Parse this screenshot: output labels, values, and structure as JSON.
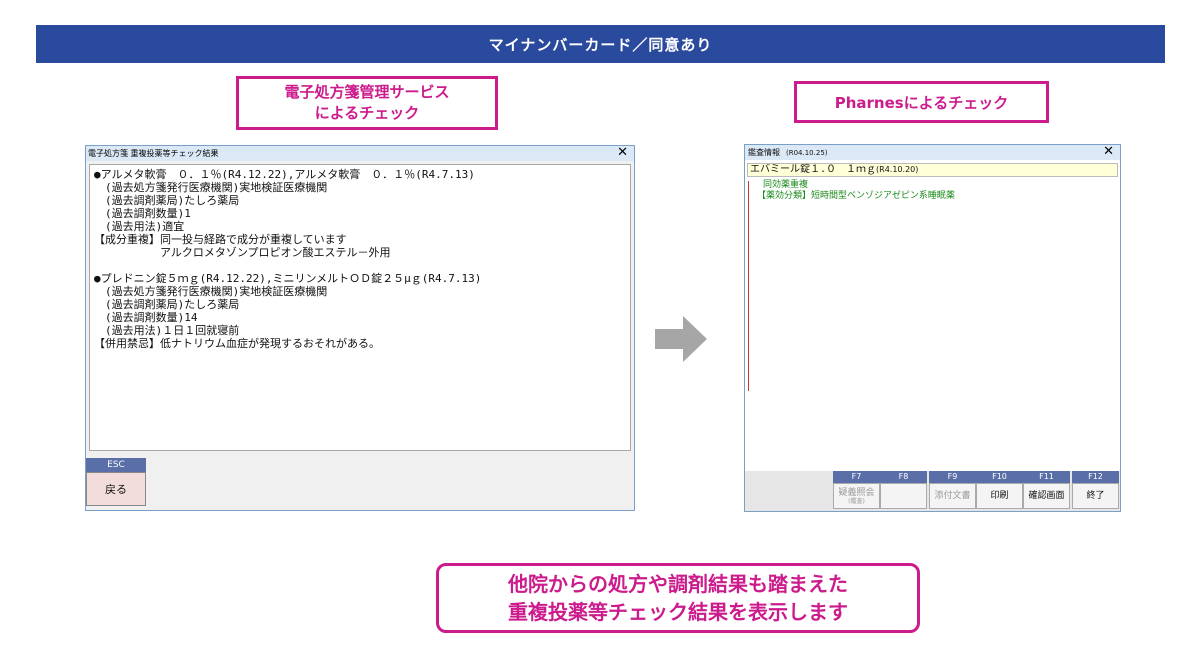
{
  "banner": {
    "text": "マイナンバーカード／同意あり"
  },
  "callouts": {
    "left_line1": "電子処方箋管理サービス",
    "left_line2": "によるチェック",
    "right": "Pharnesによるチェック",
    "bottom_line1": "他院からの処方や調剤結果も踏まえた",
    "bottom_line2": "重複投薬等チェック結果を表示します"
  },
  "left_window": {
    "title": "電子処方箋 重複投薬等チェック結果",
    "close": "✕",
    "lines": [
      "●アルメタ軟膏　０．１％(R4.12.22),アルメタ軟膏　０．１％(R4.7.13)",
      "　(過去処方箋発行医療機関)実地検証医療機関",
      "　(過去調剤薬局)たしろ薬局",
      "　(過去調剤数量)1",
      "　(過去用法)適宜",
      "【成分重複】同一投与経路で成分が重複しています",
      "　　　　　　アルクロメタゾンプロピオン酸エステル－外用",
      "",
      "●プレドニン錠５ｍｇ(R4.12.22),ミニリンメルトＯＤ錠２５μｇ(R4.7.13)",
      "　(過去処方箋発行医療機関)実地検証医療機関",
      "　(過去調剤薬局)たしろ薬局",
      "　(過去調剤数量)14",
      "　(過去用法)１日１回就寝前",
      "【併用禁忌】低ナトリウム血症が発現するおそれがある。"
    ],
    "esc_label": "ESC",
    "back_button": "戻る"
  },
  "right_window": {
    "title": "鑑査情報",
    "title_date": "(R04.10.25)",
    "close": "✕",
    "drug_name": "エバミール錠１.０　１ｍｇ",
    "drug_date": "(R4.10.20)",
    "detail_line1": "同効薬重複",
    "detail_line2": "【薬効分類】短時間型ベンゾジアゼピン系睡眠薬",
    "fkeys": [
      {
        "key": "F7",
        "label": "疑義照会",
        "sub": "(鑑査)",
        "enabled": false
      },
      {
        "key": "F8",
        "label": "",
        "sub": "",
        "enabled": false
      },
      {
        "key": "F9",
        "label": "添付文書",
        "sub": "",
        "enabled": false
      },
      {
        "key": "F10",
        "label": "印刷",
        "sub": "",
        "enabled": true
      },
      {
        "key": "F11",
        "label": "確認画面",
        "sub": "",
        "enabled": true
      },
      {
        "key": "F12",
        "label": "終了",
        "sub": "",
        "enabled": true
      }
    ]
  },
  "colors": {
    "banner": "#2a4a9e",
    "callout": "#cc1b8c",
    "arrow": "#a6a6a6",
    "detail_text": "#1a8a1a"
  }
}
